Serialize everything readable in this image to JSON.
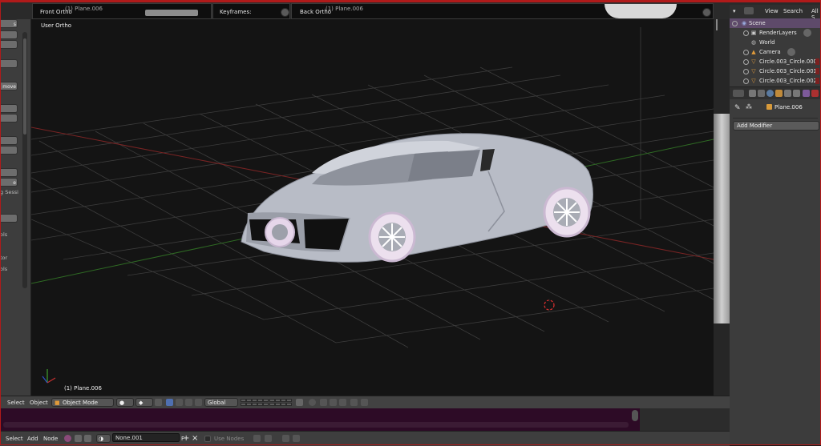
{
  "top_views": {
    "front": {
      "title": "Front Ortho",
      "object": "(1) Plane.006"
    },
    "keyframes": {
      "title": "Keyframes:"
    },
    "back": {
      "title": "Back Ortho",
      "object": "(1) Plane.006"
    }
  },
  "left_shelf": {
    "labels": [
      "s",
      "move",
      "e",
      "g Sessi",
      "ols",
      "tor",
      "ols"
    ]
  },
  "viewport": {
    "title": "User Ortho",
    "object_label": "(1) Plane.006"
  },
  "outliner_header": {
    "view": "View",
    "search": "Search",
    "all": "All S"
  },
  "outliner": {
    "items": [
      {
        "label": "Scene",
        "icon": "scene-icon"
      },
      {
        "label": "RenderLayers",
        "icon": "render-layers-icon"
      },
      {
        "label": "World",
        "icon": "world-icon"
      },
      {
        "label": "Camera",
        "icon": "camera-icon"
      },
      {
        "label": "Circle.003_Circle.000",
        "icon": "mesh-icon"
      },
      {
        "label": "Circle.003_Circle.001",
        "icon": "mesh-icon"
      },
      {
        "label": "Circle.003_Circle.002",
        "icon": "mesh-icon"
      }
    ]
  },
  "properties": {
    "object_name": "Plane.006",
    "add_modifier": "Add Modifier"
  },
  "view3d_header": {
    "select": "Select",
    "object": "Object",
    "mode": "Object Mode",
    "orientation": "Global"
  },
  "node_header": {
    "select": "Select",
    "add": "Add",
    "node": "Node",
    "material": "None.001",
    "fake_user": "F",
    "use_nodes": "Use Nodes"
  },
  "colors": {
    "selection": "#5e4a6a",
    "timeline": "#2d0b26",
    "x_axis": "#b02828",
    "y_axis": "#3c8c28"
  }
}
